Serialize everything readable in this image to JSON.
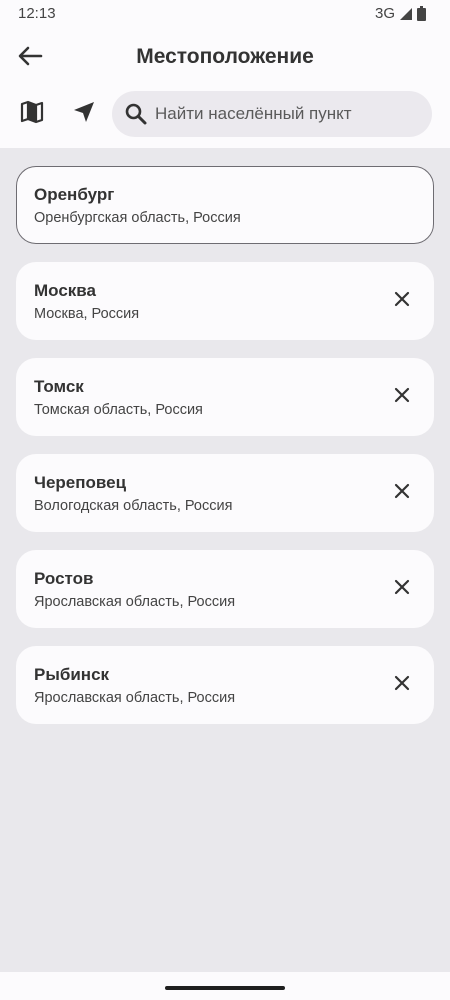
{
  "status_bar": {
    "time": "12:13",
    "network": "3G",
    "icons": [
      "signal-icon",
      "battery-icon"
    ]
  },
  "header": {
    "title": "Местоположение",
    "back_icon": "arrow-left-icon"
  },
  "toolbar": {
    "map_icon": "map-icon",
    "locate_icon": "navigation-arrow-icon",
    "search": {
      "icon": "search-icon",
      "placeholder": "Найти населённый пункт",
      "value": ""
    }
  },
  "locations": [
    {
      "name": "Оренбург",
      "region": "Оренбургская область, Россия",
      "selected": true
    },
    {
      "name": "Москва",
      "region": "Москва, Россия",
      "selected": false
    },
    {
      "name": "Томск",
      "region": "Томская область, Россия",
      "selected": false
    },
    {
      "name": "Череповец",
      "region": "Вологодская область, Россия",
      "selected": false
    },
    {
      "name": "Ростов",
      "region": "Ярославская область, Россия",
      "selected": false
    },
    {
      "name": "Рыбинск",
      "region": "Ярославская область, Россия",
      "selected": false
    }
  ],
  "colors": {
    "background": "#e9e8ec",
    "surface": "#fcfbfd",
    "text": "#333333",
    "selected_border": "#6e6c72"
  }
}
